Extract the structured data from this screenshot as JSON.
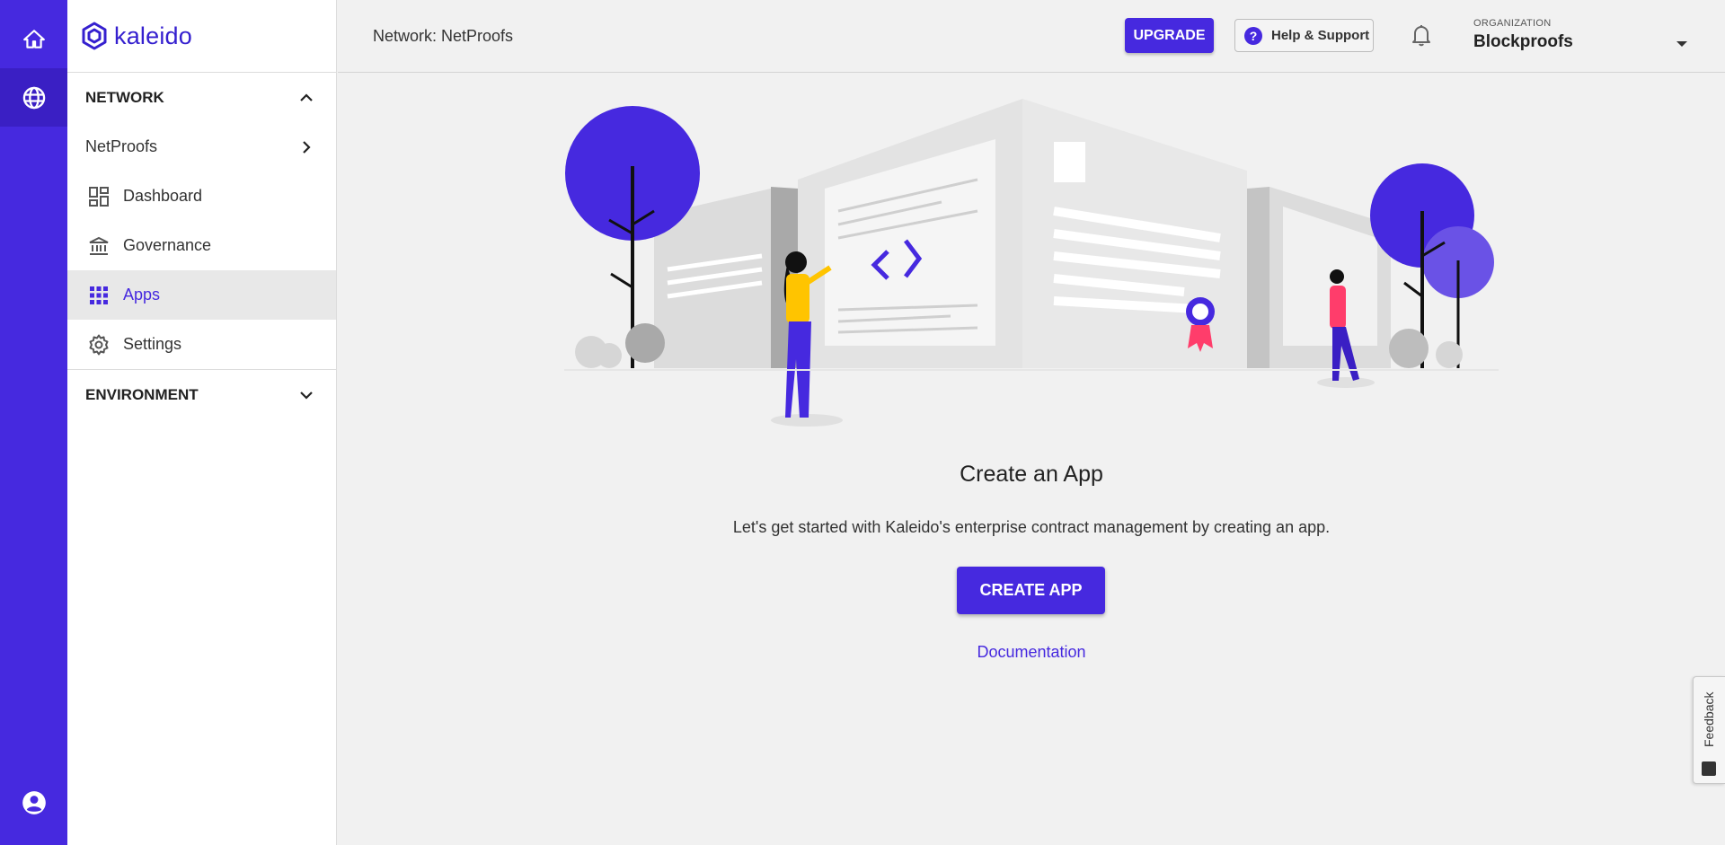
{
  "sidebar": {
    "logo_text": "kaleido",
    "network_section": "NETWORK",
    "network_name": "NetProofs",
    "items": [
      {
        "label": "Dashboard",
        "icon": "dashboard-icon"
      },
      {
        "label": "Governance",
        "icon": "bank-icon"
      },
      {
        "label": "Apps",
        "icon": "apps-grid-icon"
      },
      {
        "label": "Settings",
        "icon": "gear-icon"
      }
    ],
    "environment_section": "ENVIRONMENT"
  },
  "topbar": {
    "breadcrumb": "Network: NetProofs",
    "upgrade_label": "UPGRADE",
    "help_label": "Help & Support",
    "org_label": "ORGANIZATION",
    "org_name": "Blockproofs"
  },
  "main": {
    "title": "Create an App",
    "description": "Let's get started with Kaleido's enterprise contract management by creating an app.",
    "create_label": "CREATE APP",
    "docs_label": "Documentation"
  },
  "feedback_label": "Feedback",
  "colors": {
    "accent": "#4629df",
    "rail": "#4629df",
    "active_item_bg": "#e8e8e8"
  }
}
